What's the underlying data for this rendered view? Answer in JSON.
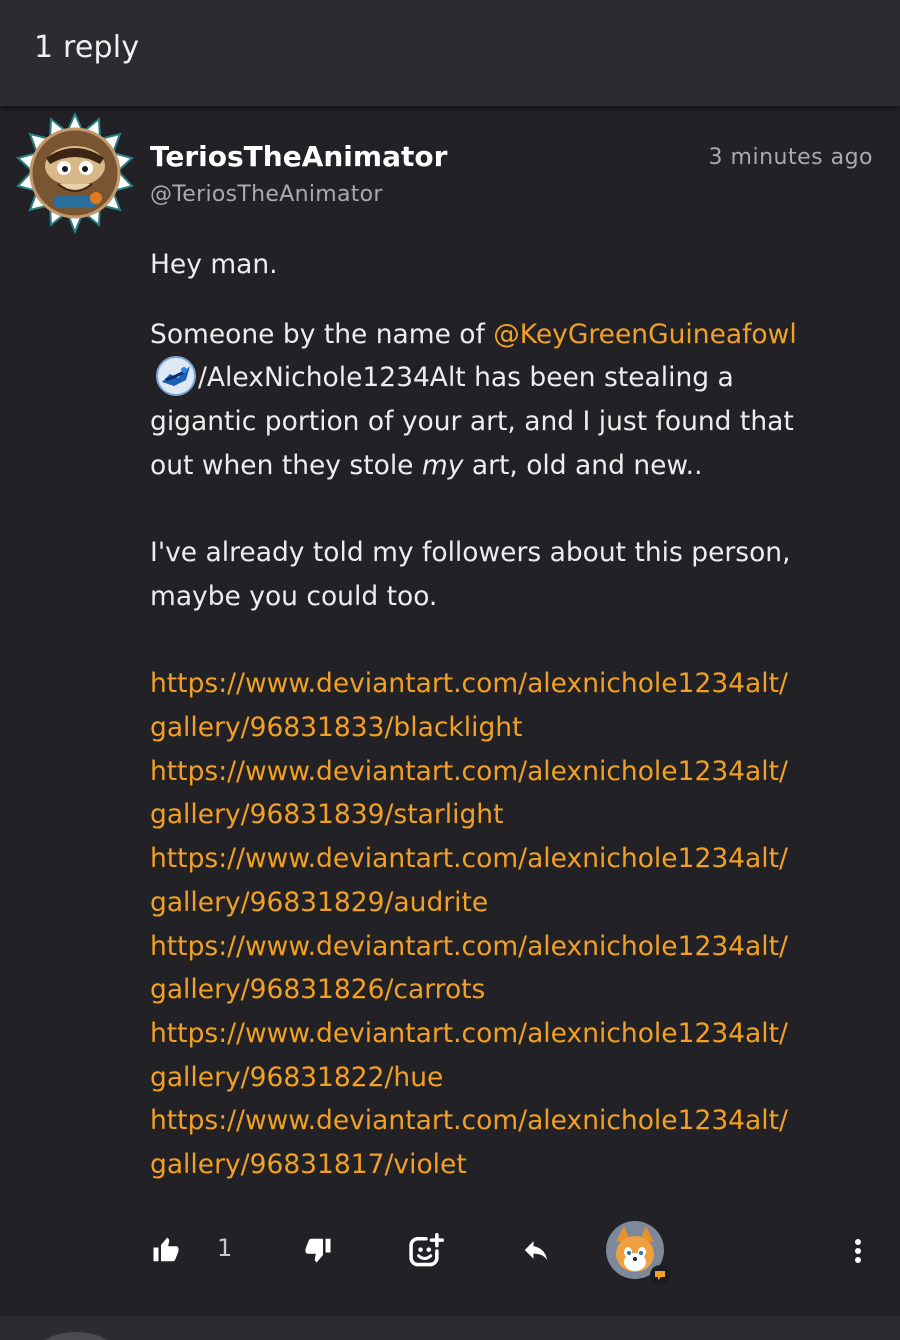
{
  "header": {
    "reply_count": "1 reply"
  },
  "comment": {
    "author_name": "TeriosTheAnimator",
    "author_handle": "@TeriosTheAnimator",
    "timestamp": "3 minutes ago",
    "greeting": "Hey man.",
    "line1_prefix": "Someone by the name of ",
    "mention": "@KeyGreenGuineafowl",
    "line2_rest": "/AlexNichole1234Alt has been stealing a",
    "line3": "gigantic portion of your art, and I just found that",
    "line4_prefix": "out when they stole ",
    "line4_em": "my",
    "line4_suffix": " art, old and new..",
    "line5": "I've already told my followers about this person,",
    "line6": "maybe you could too.",
    "links": [
      {
        "line1": "https://www.deviantart.com/alexnichole1234alt/",
        "line2": "gallery/96831833/blacklight"
      },
      {
        "line1": "https://www.deviantart.com/alexnichole1234alt/",
        "line2": "gallery/96831839/starlight"
      },
      {
        "line1": "https://www.deviantart.com/alexnichole1234alt/",
        "line2": "gallery/96831829/audrite"
      },
      {
        "line1": "https://www.deviantart.com/alexnichole1234alt/",
        "line2": "gallery/96831826/carrots"
      },
      {
        "line1": "https://www.deviantart.com/alexnichole1234alt/",
        "line2": "gallery/96831822/hue"
      },
      {
        "line1": "https://www.deviantart.com/alexnichole1234alt/",
        "line2": "gallery/96831817/violet"
      }
    ]
  },
  "actions": {
    "like_count": "1",
    "like_icon": "thumbs-up-icon",
    "dislike_icon": "thumbs-down-icon",
    "react_icon": "add-reaction-icon",
    "reply_icon": "reply-arrow-icon",
    "more_icon": "more-vertical-icon"
  },
  "colors": {
    "background": "#222226",
    "header_bg": "#2c2c30",
    "accent": "#f2a023",
    "muted_text": "#a9a9ae"
  }
}
